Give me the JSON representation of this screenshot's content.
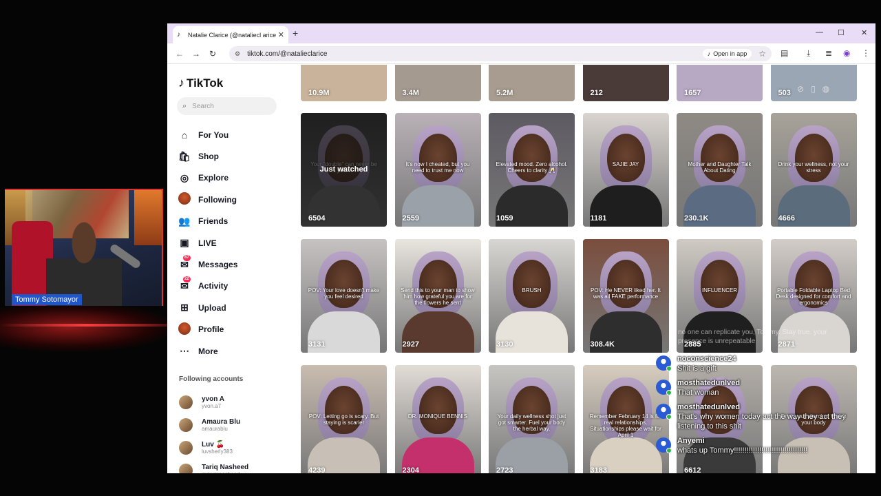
{
  "overlay": {
    "streamer_name": "Tommy Sotomayor",
    "faded_comment": "no one can replicate you, Tommy. Stay true. your presence is unrepeatable"
  },
  "browser": {
    "tab_title": "Natalie Clarice (@nataliecl arice",
    "url": "tiktok.com/@natalieclarice",
    "open_in_app": "Open in app"
  },
  "tiktok": {
    "logo": "TikTok",
    "search_placeholder": "Search",
    "nav": [
      {
        "label": "For You",
        "icon": "home-icon",
        "glyph": "⌂"
      },
      {
        "label": "Shop",
        "icon": "shopping-bag-icon",
        "glyph": "🛍"
      },
      {
        "label": "Explore",
        "icon": "compass-icon",
        "glyph": "◎"
      },
      {
        "label": "Following",
        "icon": "following-avatar-icon",
        "glyph": ""
      },
      {
        "label": "Friends",
        "icon": "friends-icon",
        "glyph": "👥"
      },
      {
        "label": "LIVE",
        "icon": "live-icon",
        "glyph": "▣"
      },
      {
        "label": "Messages",
        "icon": "messages-icon",
        "glyph": "✉",
        "badge": "87"
      },
      {
        "label": "Activity",
        "icon": "activity-icon",
        "glyph": "✉",
        "badge": "22"
      },
      {
        "label": "Upload",
        "icon": "upload-icon",
        "glyph": "⊞"
      },
      {
        "label": "Profile",
        "icon": "profile-icon",
        "glyph": ""
      },
      {
        "label": "More",
        "icon": "more-icon",
        "glyph": "⋯"
      }
    ],
    "following_title": "Following accounts",
    "following": [
      {
        "name": "yvon A",
        "handle": "yvon.a7"
      },
      {
        "name": "Amaura Blu",
        "handle": "amaurablu"
      },
      {
        "name": "Luv 🍒",
        "handle": "luvsherly383"
      },
      {
        "name": "Tariq Nasheed",
        "handle": "mrtariqnasheed"
      }
    ],
    "top_row_views": [
      "10.9M",
      "3.4M",
      "5.2M",
      "212",
      "1657",
      "503"
    ],
    "just_watched": "Just watched",
    "videos": [
      {
        "views": "6504",
        "caption": "Your \"double\" can never be you...",
        "bg": "#3b3b3b"
      },
      {
        "views": "2559",
        "caption": "It's now I cheated, but you need to trust me now",
        "bg": "#b9b1b7"
      },
      {
        "views": "1059",
        "caption": "Elevated mood. Zero alcohol. Cheers to clarity 🥂",
        "bg": "#5e5a62"
      },
      {
        "views": "1181",
        "caption": "SAJIE JAY",
        "bg": "#d9d4cf"
      },
      {
        "views": "230.1K",
        "caption": "Mother and Daughter Talk About Dating",
        "bg": "#8f8a84"
      },
      {
        "views": "4666",
        "caption": "Drink your wellness, not your stress",
        "bg": "#a7a39a"
      },
      {
        "views": "3131",
        "caption": "POV: Your love doesn't make you feel desired",
        "bg": "#c7c2c2"
      },
      {
        "views": "2927",
        "caption": "Send this to your man to show him how grateful you are for the flowers he sent",
        "bg": "#e9e5df"
      },
      {
        "views": "3130",
        "caption": "BRUSH",
        "bg": "#d8d6d2"
      },
      {
        "views": "308.4K",
        "caption": "POV: He NEVER liked her. It was all FAKE performance",
        "bg": "#7b4e3e"
      },
      {
        "views": "2885",
        "caption": "INFLUENCER",
        "bg": "#cfcac3"
      },
      {
        "views": "2871",
        "caption": "Portable Foldable Laptop Bed Desk designed for comfort and ergonomics",
        "bg": "#d3cdc8"
      },
      {
        "views": "4239",
        "caption": "POV: Letting go is scary. But staying is scarier",
        "bg": "#c9bcb0"
      },
      {
        "views": "2304",
        "caption": "DR. MONIQUE BENNIS",
        "bg": "#e2dcd6"
      },
      {
        "views": "2723",
        "caption": "Your daily wellness shot just got smarter. Fuel your body the herbal way.",
        "bg": "#c7c5c2"
      },
      {
        "views": "3183",
        "caption": "Remember February 14 is for real relationships. Situationships please wait for April 1",
        "bg": "#d7cdbf"
      },
      {
        "views": "6612",
        "caption": "",
        "bg": "#b1aca6"
      },
      {
        "views": "",
        "caption": "Drink your vitamins! Watch your body",
        "bg": "#bdb7b0"
      }
    ]
  },
  "chat": [
    {
      "user": "noconscience24",
      "text": "Shit is a gift"
    },
    {
      "user": "mosthatedunlved",
      "text": "That woman"
    },
    {
      "user": "mosthatedunlved",
      "text": "That's why women today act the way they act they listening to this shit"
    },
    {
      "user": "Anyemi",
      "text": "whats up Tommy!!!!!!!!!!!!!!!!!!!!!!!!!!!!!!!!!!!"
    }
  ]
}
